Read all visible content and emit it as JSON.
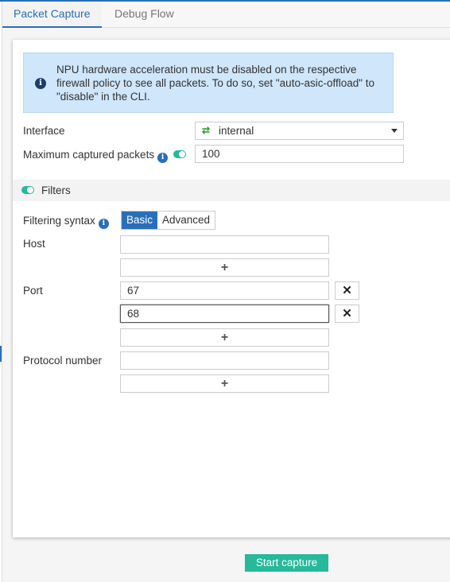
{
  "tabs": [
    {
      "label": "Packet Capture",
      "active": true
    },
    {
      "label": "Debug Flow",
      "active": false
    }
  ],
  "notice": {
    "icon": "info-icon",
    "text": "NPU hardware acceleration must be disabled on the respective firewall policy to see all packets. To do so, set \"auto-asic-offload\" to \"disable\" in the CLI."
  },
  "interface": {
    "label": "Interface",
    "value": "internal",
    "icon": "shuffle-icon"
  },
  "max_packets": {
    "label": "Maximum captured packets",
    "enabled": true,
    "value": "100"
  },
  "filters": {
    "label": "Filters",
    "enabled": true,
    "syntax": {
      "label": "Filtering syntax",
      "options": [
        "Basic",
        "Advanced"
      ],
      "selected": "Basic"
    },
    "host": {
      "label": "Host",
      "values": [
        ""
      ]
    },
    "port": {
      "label": "Port",
      "values": [
        "67",
        "68"
      ]
    },
    "protocol": {
      "label": "Protocol number",
      "values": [
        ""
      ]
    },
    "add_label": "+",
    "remove_label": "✕"
  },
  "start_button": "Start capture",
  "colors": {
    "accent": "#2a6ebb",
    "toggle": "#26b99a",
    "notice_bg": "#cfe6fb"
  }
}
